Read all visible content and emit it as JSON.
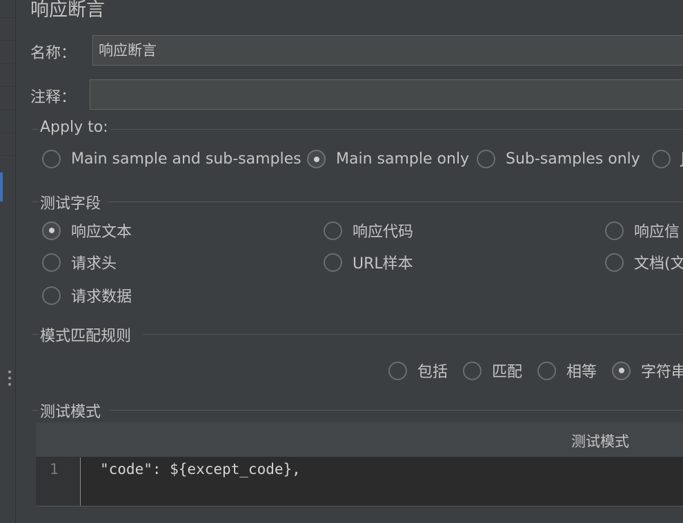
{
  "panel": {
    "title": "响应断言"
  },
  "name_field": {
    "label": "名称：",
    "value": "响应断言"
  },
  "comment_field": {
    "label": "注释：",
    "value": ""
  },
  "apply_to": {
    "title": "Apply to:",
    "options": [
      {
        "label": "Main sample and sub-samples",
        "checked": false
      },
      {
        "label": "Main sample only",
        "checked": true
      },
      {
        "label": "Sub-samples only",
        "checked": false
      },
      {
        "label": "J",
        "checked": false
      }
    ]
  },
  "test_field": {
    "title": "测试字段",
    "options": [
      {
        "label": "响应文本",
        "checked": true
      },
      {
        "label": "响应代码",
        "checked": false
      },
      {
        "label": "响应信",
        "checked": false
      },
      {
        "label": "请求头",
        "checked": false
      },
      {
        "label": "URL样本",
        "checked": false
      },
      {
        "label": "文档(文",
        "checked": false
      },
      {
        "label": "请求数据",
        "checked": false
      }
    ]
  },
  "pattern_rules": {
    "title": "模式匹配规则",
    "options": [
      {
        "label": "包括",
        "checked": false
      },
      {
        "label": "匹配",
        "checked": false
      },
      {
        "label": "相等",
        "checked": false
      },
      {
        "label": "字符串",
        "checked": true
      }
    ]
  },
  "test_patterns": {
    "title": "测试模式",
    "column_header": "测试模式",
    "rows": [
      {
        "line": "1",
        "code": "\"code\": ${except_code},"
      }
    ]
  }
}
